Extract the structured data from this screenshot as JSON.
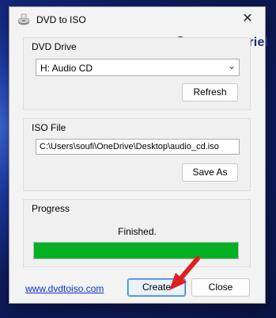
{
  "window": {
    "title": "DVD to ISO",
    "close_icon": "close-icon"
  },
  "brand": {
    "name": "EasyTutoriel",
    "logo_icon": "easytutoriel-logo-icon"
  },
  "dvd_drive": {
    "label": "DVD Drive",
    "selected": "H: Audio CD",
    "refresh_label": "Refresh"
  },
  "iso_file": {
    "label": "ISO File",
    "path": "C:\\Users\\soufi\\OneDrive\\Desktop\\audio_cd.iso",
    "save_as_label": "Save As"
  },
  "progress": {
    "label": "Progress",
    "status": "Finished.",
    "value": 1.0,
    "fill_color": "#06b025"
  },
  "footer": {
    "link": "www.dvdtoiso.com",
    "create_label": "Create",
    "close_label": "Close"
  },
  "annotation": {
    "arrow_color": "#e02020"
  }
}
